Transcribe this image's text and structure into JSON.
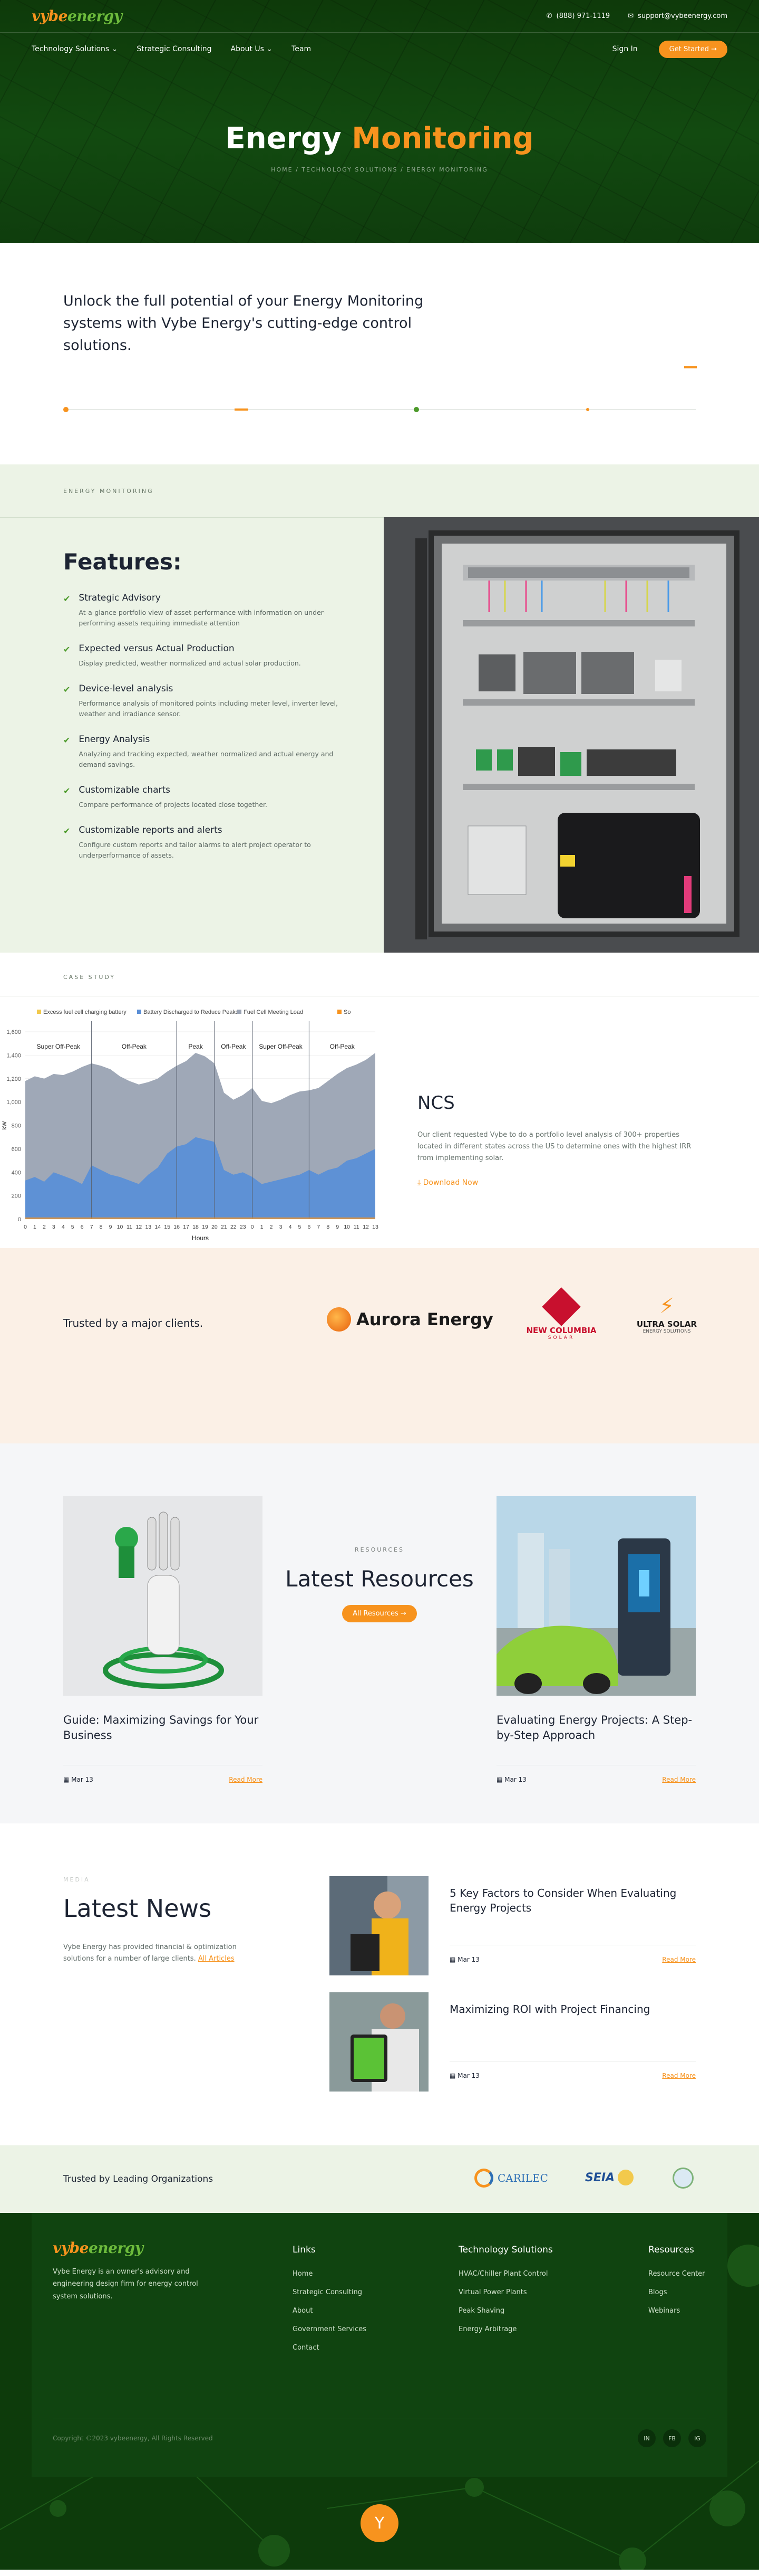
{
  "header": {
    "logo_v": "vybe",
    "logo_e": "energy",
    "phone": "(888) 971-1119",
    "email": "support@vybeenergy.com"
  },
  "nav": {
    "items": [
      "Technology Solutions ⌄",
      "Strategic Consulting",
      "About Us ⌄",
      "Team"
    ],
    "sign_in": "Sign In",
    "cta": "Get Started →"
  },
  "hero": {
    "title_a": "Energy ",
    "title_b": "Monitoring",
    "breadcrumb": "HOME / TECHNOLOGY SOLUTIONS / ENERGY MONITORING"
  },
  "intro": {
    "text": "Unlock the full potential of your Energy Monitoring systems with Vybe Energy's cutting-edge control solutions."
  },
  "features": {
    "eyebrow": "ENERGY MONITORING",
    "title": "Features:",
    "items": [
      {
        "title": "Strategic Advisory",
        "desc": "At-a-glance portfolio view of asset performance with information on under-performing assets requiring immediate attention"
      },
      {
        "title": "Expected versus Actual Production",
        "desc": "Display predicted, weather normalized and actual solar production."
      },
      {
        "title": "Device-level analysis",
        "desc": "Performance analysis of monitored points including meter level, inverter level, weather and irradiance sensor."
      },
      {
        "title": "Energy Analysis",
        "desc": "Analyzing and tracking expected, weather normalized and actual energy and demand savings."
      },
      {
        "title": "Customizable charts",
        "desc": "Compare performance of projects located close together."
      },
      {
        "title": "Customizable reports and alerts",
        "desc": "Configure custom reports and tailor alarms to alert project operator to underperformance of assets."
      }
    ]
  },
  "case_study": {
    "eyebrow": "CASE STUDY",
    "title": "NCS",
    "desc": "Our client requested Vybe to do a portfolio level analysis of 300+ properties located in different states across the US to determine ones with the highest IRR from implementing solar.",
    "download": "Download Now"
  },
  "chart_data": {
    "type": "area",
    "legend": [
      "Excess fuel cell charging battery",
      "Battery Discharged to Reduce Peaks",
      "Fuel Cell Meeting Load",
      "So"
    ],
    "series_colors": [
      "#f2c94c",
      "#5b8fd6",
      "#9aa3b3",
      "#f7931e"
    ],
    "xlabel": "Hours",
    "ylabel": "kW",
    "ylim": [
      0,
      1600
    ],
    "yticks": [
      "0",
      "200",
      "400",
      "600",
      "800",
      "1,000",
      "1,200",
      "1,400",
      "1,600"
    ],
    "x": [
      "0",
      "1",
      "2",
      "3",
      "4",
      "5",
      "6",
      "7",
      "8",
      "9",
      "10",
      "11",
      "12",
      "13",
      "14",
      "15",
      "16",
      "17",
      "18",
      "19",
      "20",
      "21",
      "22",
      "23",
      "0",
      "1",
      "2",
      "3",
      "4",
      "5",
      "6",
      "7",
      "8",
      "9",
      "10",
      "11",
      "12",
      "13"
    ],
    "series": [
      {
        "name": "Fuel Cell Meeting Load",
        "values": [
          1180,
          1220,
          1200,
          1240,
          1230,
          1260,
          1300,
          1330,
          1310,
          1280,
          1220,
          1180,
          1150,
          1170,
          1200,
          1260,
          1310,
          1350,
          1420,
          1390,
          1330,
          1080,
          1020,
          1060,
          1120,
          1010,
          990,
          1020,
          1060,
          1090,
          1100,
          1120,
          1180,
          1240,
          1290,
          1320,
          1360,
          1420
        ]
      },
      {
        "name": "Battery Discharged to Reduce Peaks",
        "values": [
          330,
          360,
          320,
          400,
          370,
          340,
          300,
          460,
          420,
          380,
          360,
          330,
          300,
          380,
          440,
          560,
          620,
          640,
          700,
          680,
          660,
          420,
          380,
          400,
          360,
          300,
          320,
          340,
          360,
          380,
          420,
          380,
          420,
          440,
          500,
          520,
          560,
          600
        ]
      },
      {
        "name": "Excess fuel cell charging battery",
        "values": [
          0,
          0,
          0,
          0,
          0,
          0,
          0,
          0,
          0,
          0,
          0,
          0,
          0,
          0,
          0,
          0,
          0,
          0,
          0,
          0,
          0,
          0,
          0,
          0,
          0,
          0,
          0,
          0,
          0,
          0,
          0,
          0,
          0,
          0,
          0,
          0,
          0,
          0
        ]
      }
    ],
    "periods": [
      "Super Off-Peak",
      "Off-Peak",
      "Peak",
      "Off-Peak",
      "Super Off-Peak",
      "Off-Peak"
    ]
  },
  "clients": {
    "label": "Trusted by a major clients.",
    "aurora": "Aurora Energy",
    "newcol_1": "NEW COLUMBIA",
    "newcol_2": "SOLAR",
    "ultra_1": "ULTRA SOLAR",
    "ultra_2": "ENERGY SOLUTIONS"
  },
  "resources": {
    "eyebrow": "RESOURCES",
    "title": "Latest Resources",
    "button": "All Resources →",
    "cards": [
      {
        "title": "Guide: Maximizing Savings for Your Business",
        "date": "Mar 13",
        "read": "Read More"
      },
      {
        "title": "Evaluating Energy Projects: A Step-by-Step Approach",
        "date": "Mar 13",
        "read": "Read More"
      }
    ]
  },
  "news": {
    "eyebrow": "MEDIA",
    "title": "Latest News",
    "desc": "Vybe Energy has provided financial & optimization solutions for a number of large clients.",
    "all_link": "All Articles",
    "items": [
      {
        "title": "5 Key Factors to Consider When Evaluating Energy Projects",
        "date": "Mar 13",
        "read": "Read More"
      },
      {
        "title": "Maximizing ROI with Project Financing",
        "date": "Mar 13",
        "read": "Read More"
      }
    ]
  },
  "orgs": {
    "label": "Trusted by Leading Organizations",
    "carilec": "CARILEC",
    "seia": "SEIA"
  },
  "footer": {
    "about": "Vybe Energy is an owner's advisory and engineering design firm for energy control system solutions.",
    "links_title": "Links",
    "links": [
      "Home",
      "Strategic Consulting",
      "About",
      "Government Services",
      "Contact"
    ],
    "tech_title": "Technology Solutions",
    "tech": [
      "HVAC/Chiller Plant Control",
      "Virtual Power Plants",
      "Peak Shaving",
      "Energy Arbitrage"
    ],
    "res_title": "Resources",
    "res": [
      "Resource Center",
      "Blogs",
      "Webinars"
    ],
    "copyright": "Copyright ©2023 vybeenergy, All Rights Reserved",
    "social": [
      "IN",
      "FB",
      "IG"
    ]
  },
  "colors": {
    "brand_green": "#0e3a0a",
    "accent_orange": "#f7931e",
    "light_green": "#ecf3e6"
  }
}
